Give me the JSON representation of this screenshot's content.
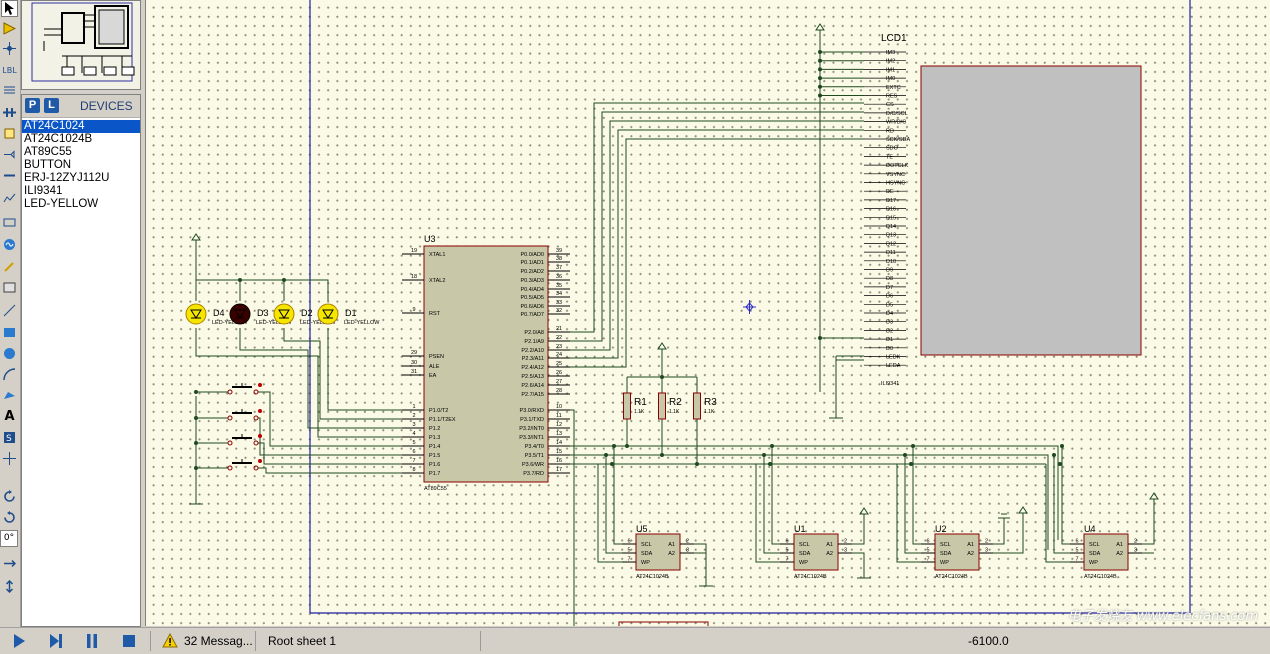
{
  "toolbar": {
    "tools": [
      "pointer-icon",
      "component-icon",
      "junction-icon",
      "wire-label-icon",
      "text-script-icon",
      "bus-icon",
      "subcircuit-icon",
      "terminal-icon",
      "pin-icon",
      "graph-icon",
      "tape-icon",
      "generator-icon",
      "probe-icon",
      "instrument-icon",
      "line-icon",
      "box-icon",
      "circle-icon",
      "arc-icon",
      "path-icon",
      "text-icon",
      "symbol-icon",
      "marker-icon",
      "rotate-cw-icon",
      "rotate-ccw-icon",
      "angle-field",
      "flip-h-icon",
      "flip-v-icon"
    ],
    "angle_value": "0°"
  },
  "devices": {
    "p_label": "P",
    "l_label": "L",
    "title": "DEVICES",
    "items": [
      "AT24C1024",
      "AT24C1024B",
      "AT89C55",
      "BUTTON",
      "ERJ-12ZYJ112U",
      "ILI9341",
      "LED-YELLOW"
    ],
    "selected": 0
  },
  "schematic": {
    "u3": {
      "ref": "U3",
      "part": "AT89C55",
      "left_pins": [
        {
          "num": "19",
          "name": "XTAL1"
        },
        {
          "num": "18",
          "name": "XTAL2"
        },
        {
          "num": "9",
          "name": "RST"
        },
        {
          "num": "29",
          "name": "PSEN"
        },
        {
          "num": "30",
          "name": "ALE"
        },
        {
          "num": "31",
          "name": "EA"
        },
        {
          "num": "1",
          "name": "P1.0/T2"
        },
        {
          "num": "2",
          "name": "P1.1/T2EX"
        },
        {
          "num": "3",
          "name": "P1.2"
        },
        {
          "num": "4",
          "name": "P1.3"
        },
        {
          "num": "5",
          "name": "P1.4"
        },
        {
          "num": "6",
          "name": "P1.5"
        },
        {
          "num": "7",
          "name": "P1.6"
        },
        {
          "num": "8",
          "name": "P1.7"
        }
      ],
      "right_pins": [
        {
          "num": "39",
          "name": "P0.0/AD0"
        },
        {
          "num": "38",
          "name": "P0.1/AD1"
        },
        {
          "num": "37",
          "name": "P0.2/AD2"
        },
        {
          "num": "36",
          "name": "P0.3/AD3"
        },
        {
          "num": "35",
          "name": "P0.4/AD4"
        },
        {
          "num": "34",
          "name": "P0.5/AD5"
        },
        {
          "num": "33",
          "name": "P0.6/AD6"
        },
        {
          "num": "32",
          "name": "P0.7/AD7"
        },
        {
          "num": "21",
          "name": "P2.0/A8"
        },
        {
          "num": "22",
          "name": "P2.1/A9"
        },
        {
          "num": "23",
          "name": "P2.2/A10"
        },
        {
          "num": "24",
          "name": "P2.3/A11"
        },
        {
          "num": "25",
          "name": "P2.4/A12"
        },
        {
          "num": "26",
          "name": "P2.5/A13"
        },
        {
          "num": "27",
          "name": "P2.6/A14"
        },
        {
          "num": "28",
          "name": "P2.7/A15"
        },
        {
          "num": "10",
          "name": "P3.0/RXD"
        },
        {
          "num": "11",
          "name": "P3.1/TXD"
        },
        {
          "num": "12",
          "name": "P3.2/INT0"
        },
        {
          "num": "13",
          "name": "P3.3/INT1"
        },
        {
          "num": "14",
          "name": "P3.4/T0"
        },
        {
          "num": "15",
          "name": "P3.5/T1"
        },
        {
          "num": "16",
          "name": "P3.6/WR"
        },
        {
          "num": "17",
          "name": "P3.7/RD"
        }
      ]
    },
    "lcd": {
      "ref": "LCD1",
      "part": "ILI9341",
      "pins": [
        "IM3",
        "IM2",
        "IM1",
        "IM0",
        "EXTC",
        "RES",
        "CS",
        "D/C/SCL",
        "WR/D/C",
        "RD",
        "SCK/SDA",
        "SDO",
        "TE",
        "DOTCLK",
        "VSYNC",
        "HSYNC",
        "DE",
        "D17",
        "D16",
        "D15",
        "D14",
        "D13",
        "D12",
        "D11",
        "D10",
        "D9",
        "D8",
        "D7",
        "D6",
        "D5",
        "D4",
        "D3",
        "D2",
        "D1",
        "D0",
        "LEDK",
        "LEDA"
      ]
    },
    "leds": [
      {
        "ref": "D4",
        "part": "LED-YELLOW",
        "lit": false,
        "color": "#f5e600"
      },
      {
        "ref": "D3",
        "part": "LED-YELLOW",
        "lit": true,
        "color": "#3a0000"
      },
      {
        "ref": "D2",
        "part": "LED-YELLOW",
        "lit": false,
        "color": "#f5e600"
      },
      {
        "ref": "D1",
        "part": "LED-YELLOW",
        "lit": false,
        "color": "#f5e600"
      }
    ],
    "resistors": [
      {
        "ref": "R1",
        "value": "1.1K"
      },
      {
        "ref": "R2",
        "value": "1.1K"
      },
      {
        "ref": "R3",
        "value": "1.1K"
      }
    ],
    "eeproms": [
      {
        "ref": "U5",
        "part": "AT24C1024B"
      },
      {
        "ref": "U1",
        "part": "AT24C1024B"
      },
      {
        "ref": "U2",
        "part": "AT24C1024B"
      },
      {
        "ref": "U4",
        "part": "AT24C1024B"
      }
    ],
    "eeprom_pins": {
      "left": [
        {
          "num": "6",
          "name": "SCL"
        },
        {
          "num": "5",
          "name": "SDA"
        },
        {
          "num": "7",
          "name": "WP"
        }
      ],
      "right": [
        {
          "num": "2",
          "name": "A1"
        },
        {
          "num": "3",
          "name": "A2"
        }
      ]
    }
  },
  "status": {
    "messages": "32 Messag...",
    "sheet": "Root sheet 1",
    "coord": "-6100.0"
  },
  "watermark": "电子发烧友 www.elecfans.com",
  "colors": {
    "wire": "#1f4a1f",
    "component_fill": "#c8c8a8",
    "component_border": "#8b0000",
    "lcd_screen": "#c0c0c0",
    "sheet_border": "#1e1ea0"
  }
}
